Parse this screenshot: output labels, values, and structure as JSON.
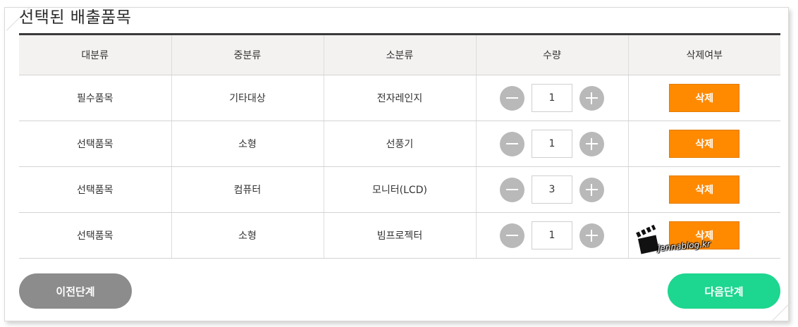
{
  "page_title": "선택된 배출품목",
  "table": {
    "headers": [
      "대분류",
      "중분류",
      "소분류",
      "수량",
      "삭제여부"
    ],
    "rows": [
      {
        "major": "필수품목",
        "middle": "기타대상",
        "minor": "전자레인지",
        "qty": "1",
        "delete_label": "삭제"
      },
      {
        "major": "선택품목",
        "middle": "소형",
        "minor": "선풍기",
        "qty": "1",
        "delete_label": "삭제"
      },
      {
        "major": "선택품목",
        "middle": "컴퓨터",
        "minor": "모니터(LCD)",
        "qty": "3",
        "delete_label": "삭제"
      },
      {
        "major": "선택품목",
        "middle": "소형",
        "minor": "빔프로젝터",
        "qty": "1",
        "delete_label": "삭제"
      }
    ]
  },
  "buttons": {
    "prev_label": "이전단계",
    "next_label": "다음단계"
  },
  "watermark": {
    "text": "jennablog.kr"
  },
  "colors": {
    "delete_button": "#ff8a00",
    "next_button": "#1dd68f",
    "prev_button": "#8c8c8c",
    "stepper_button": "#b9b9b9"
  },
  "icons": {
    "decrease": "minus-icon",
    "increase": "plus-icon"
  }
}
